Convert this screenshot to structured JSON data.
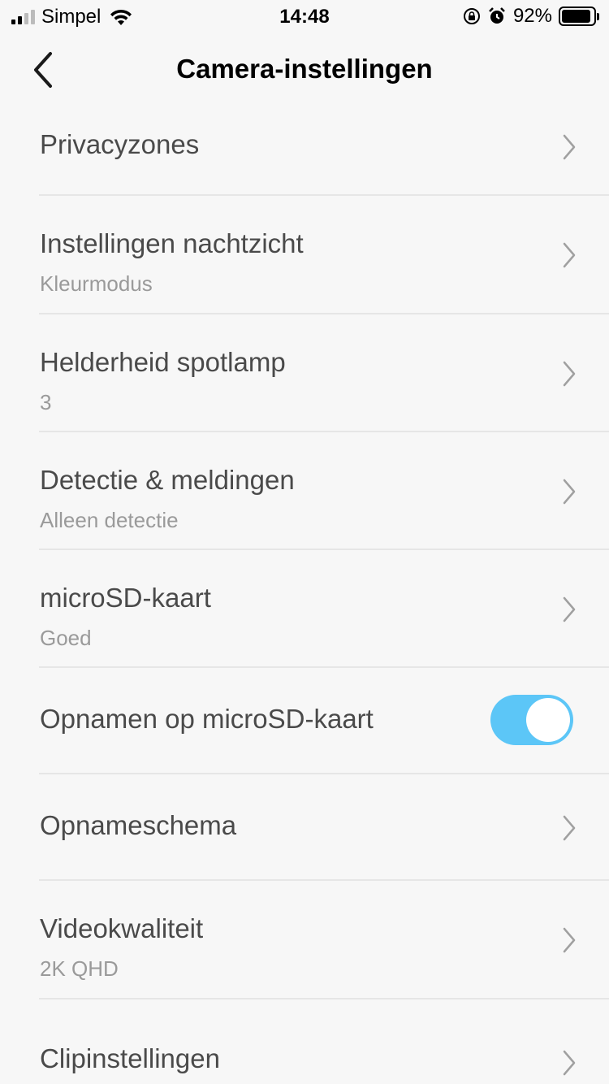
{
  "status": {
    "carrier": "Simpel",
    "time": "14:48",
    "battery_pct": "92%",
    "battery_level": 0.92,
    "icons": [
      "signal-icon",
      "wifi-icon",
      "rotation-lock-icon",
      "alarm-icon",
      "battery-icon"
    ]
  },
  "nav": {
    "title": "Camera-instellingen",
    "back_icon": "chevron-left-icon"
  },
  "settings": [
    {
      "title": "Privacyzones",
      "subtitle": "",
      "type": "link"
    },
    {
      "title": "Instellingen nachtzicht",
      "subtitle": "Kleurmodus",
      "type": "link"
    },
    {
      "title": "Helderheid spotlamp",
      "subtitle": "3",
      "type": "link"
    },
    {
      "title": "Detectie & meldingen",
      "subtitle": "Alleen detectie",
      "type": "link"
    },
    {
      "title": "microSD-kaart",
      "subtitle": "Goed",
      "type": "link"
    },
    {
      "title": "Opnamen op microSD-kaart",
      "subtitle": "",
      "type": "toggle",
      "on": true
    },
    {
      "title": "Opnameschema",
      "subtitle": "",
      "type": "link"
    },
    {
      "title": "Videokwaliteit",
      "subtitle": "2K QHD",
      "type": "link"
    },
    {
      "title": "Clipinstellingen",
      "subtitle": "",
      "type": "link"
    }
  ],
  "colors": {
    "toggle_on": "#5cc6f7",
    "background": "#f7f7f7",
    "divider": "#e6e6e6"
  }
}
